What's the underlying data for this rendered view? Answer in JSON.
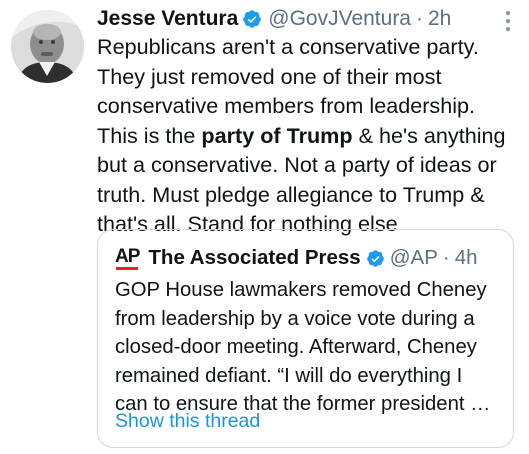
{
  "tweet": {
    "author": {
      "display_name": "Jesse Ventura",
      "handle": "@GovJVentura",
      "verified": true,
      "avatar_icon": "profile-photo"
    },
    "separator": "·",
    "time": "2h",
    "text_segments": [
      {
        "text": "Republicans aren't a conservative party. They just removed one of their most conservative members from leadership. This is the ",
        "bold": false
      },
      {
        "text": "party of Trump",
        "bold": true
      },
      {
        "text": " & he's anything but a conservative. Not a party of ideas or truth. Must pledge allegiance to Trump & that's all. Stand for nothing else",
        "bold": false
      }
    ],
    "more_icon": "more-vertical-icon"
  },
  "quoted_tweet": {
    "logo": {
      "letters": "AP",
      "bar_color": "#e0262c"
    },
    "display_name": "The Associated Press",
    "handle": "@AP",
    "verified": true,
    "separator": "·",
    "time": "4h",
    "text": "GOP House lawmakers removed Cheney from leadership by a voice vote during a closed-door meeting. Afterward, Cheney remained defiant. “I will do everything I can to ensure that the former president …",
    "show_thread_label": "Show this thread"
  },
  "colors": {
    "text_primary": "#0f1419",
    "text_secondary": "#5b7083",
    "link": "#1b95e0",
    "verified_badge": "#1d9bf0",
    "border": "#cfd9de"
  }
}
